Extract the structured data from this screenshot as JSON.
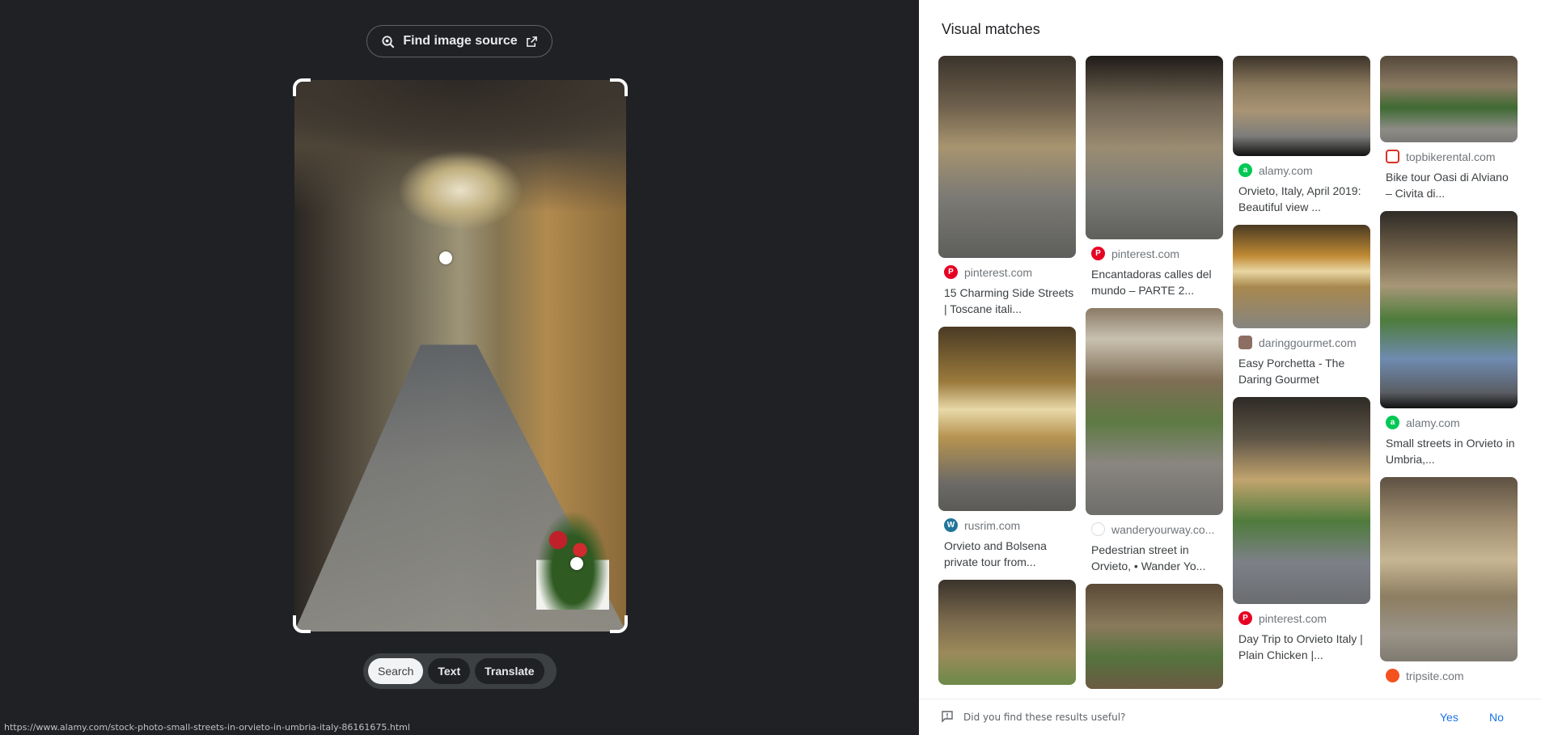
{
  "toolbar": {
    "find_source_label": "Find image source"
  },
  "modes": [
    "Search",
    "Text",
    "Translate"
  ],
  "status_url": "https://www.alamy.com/stock-photo-small-streets-in-orvieto-in-umbria-italy-86161675.html",
  "results": {
    "title": "Visual matches",
    "columns": [
      [
        {
          "source": "pinterest.com",
          "caption": "15 Charming Side Streets | Toscane itali...",
          "favicon": "pinterest-icon",
          "color": "#e60023"
        },
        {
          "source": "rusrim.com",
          "caption": "Orvieto and Bolsena private tour from...",
          "favicon": "wordpress-icon",
          "color": "#21759b"
        },
        {
          "source": "",
          "caption": "",
          "favicon": "",
          "color": ""
        }
      ],
      [
        {
          "source": "pinterest.com",
          "caption": "Encantadoras calles del mundo – PARTE 2...",
          "favicon": "pinterest-icon",
          "color": "#e60023"
        },
        {
          "source": "wanderyourway.co...",
          "caption": "Pedestrian street in Orvieto, • Wander Yo...",
          "favicon": "globe-icon",
          "color": "#dadce0"
        },
        {
          "source": "",
          "caption": "",
          "favicon": "",
          "color": ""
        }
      ],
      [
        {
          "source": "alamy.com",
          "caption": "Orvieto, Italy, April 2019: Beautiful view ...",
          "favicon": "alamy-icon",
          "color": "#00c853"
        },
        {
          "source": "daringgourmet.com",
          "caption": "Easy Porchetta - The Daring Gourmet",
          "favicon": "daringgourmet-icon",
          "color": "#8d6e63"
        },
        {
          "source": "pinterest.com",
          "caption": "Day Trip to Orvieto Italy | Plain Chicken |...",
          "favicon": "pinterest-icon",
          "color": "#e60023"
        }
      ],
      [
        {
          "source": "topbikerental.com",
          "caption": "Bike tour Oasi di Alviano – Civita di...",
          "favicon": "topbikerental-icon",
          "color": "#d93025"
        },
        {
          "source": "alamy.com",
          "caption": "Small streets in Orvieto in Umbria,...",
          "favicon": "alamy-icon",
          "color": "#00c853"
        },
        {
          "source": "tripsite.com",
          "caption": "",
          "favicon": "tripsite-icon",
          "color": "#f4511e"
        }
      ]
    ]
  },
  "feedback": {
    "question": "Did you find these results useful?",
    "yes": "Yes",
    "no": "No"
  }
}
